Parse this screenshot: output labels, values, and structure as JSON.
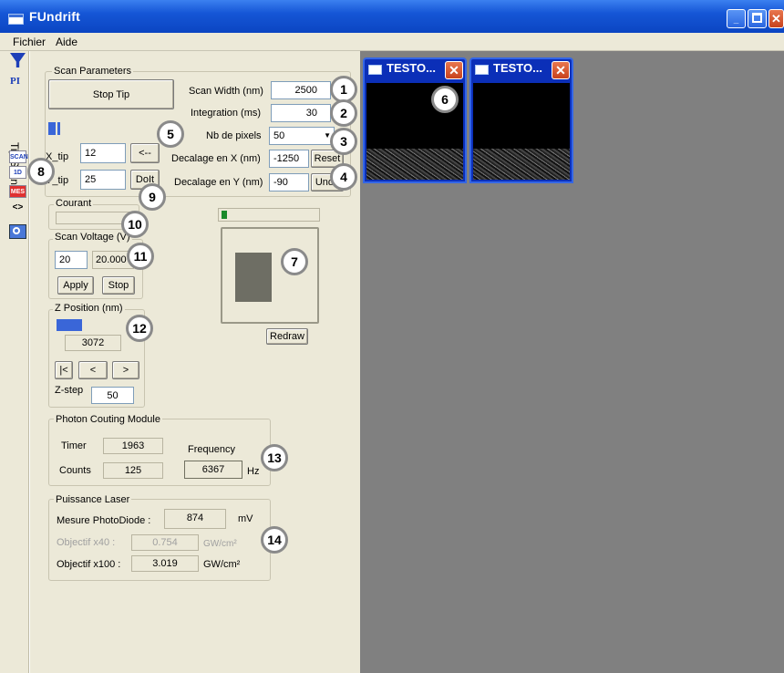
{
  "window": {
    "title": "FUndrift"
  },
  "menu": {
    "items": [
      "Fichier",
      "Aide"
    ]
  },
  "toolstrip": {
    "tab_label": "Tip Scan",
    "pi_label": "PI",
    "btn_scan": "SCAN",
    "btn_1d": "1D",
    "btn_mes": "MES"
  },
  "scan_params": {
    "group_label": "Scan Parameters",
    "stop_tip": "Stop Tip",
    "scan_width_label": "Scan Width (nm)",
    "scan_width": "2500",
    "integration_label": "Integration (ms)",
    "integration": "30",
    "nb_pixels_label": "Nb de pixels",
    "nb_pixels": "50",
    "xtip_label": "X_tip",
    "xtip": "12",
    "back_btn": "<--",
    "ytip_label": "Y_tip",
    "ytip": "25",
    "doit_btn": "DoIt",
    "decal_x_label": "Decalage en X (nm)",
    "decal_x": "-1250",
    "reset_btn": "Reset",
    "decal_y_label": "Decalage en Y (nm)",
    "decal_y": "-90",
    "undo_btn": "Undo",
    "progress": 0.3
  },
  "courant": {
    "label": "Courant"
  },
  "scan_voltage": {
    "label": "Scan Voltage (V)",
    "value": "20",
    "readout": "20.000",
    "apply": "Apply",
    "stop": "Stop"
  },
  "zpos": {
    "label": "Z Position (nm)",
    "value": "3072",
    "first": "|<",
    "prev": "<",
    "next": ">",
    "zstep_label": "Z-step",
    "zstep": "50",
    "level": 0.4
  },
  "preview": {
    "redraw": "Redraw"
  },
  "photon": {
    "label": "Photon Couting Module",
    "timer_label": "Timer",
    "timer": "1963",
    "counts_label": "Counts",
    "counts": "125",
    "freq_label": "Frequency",
    "freq": "6367",
    "freq_unit": "Hz"
  },
  "laser": {
    "label": "Puissance Laser",
    "mesure_label": "Mesure PhotoDiode :",
    "mesure": "874",
    "mesure_unit": "mV",
    "obj40_label": "Objectif x40 :",
    "obj40": "0.754",
    "obj40_unit": "GW/cm²",
    "obj100_label": "Objectif x100 :",
    "obj100": "3.019",
    "obj100_unit": "GW/cm²"
  },
  "children": [
    {
      "title": "TESTO..."
    },
    {
      "title": "TESTO..."
    }
  ],
  "badges": [
    "1",
    "2",
    "3",
    "4",
    "5",
    "6",
    "7",
    "8",
    "9",
    "10",
    "11",
    "12",
    "13",
    "14"
  ]
}
